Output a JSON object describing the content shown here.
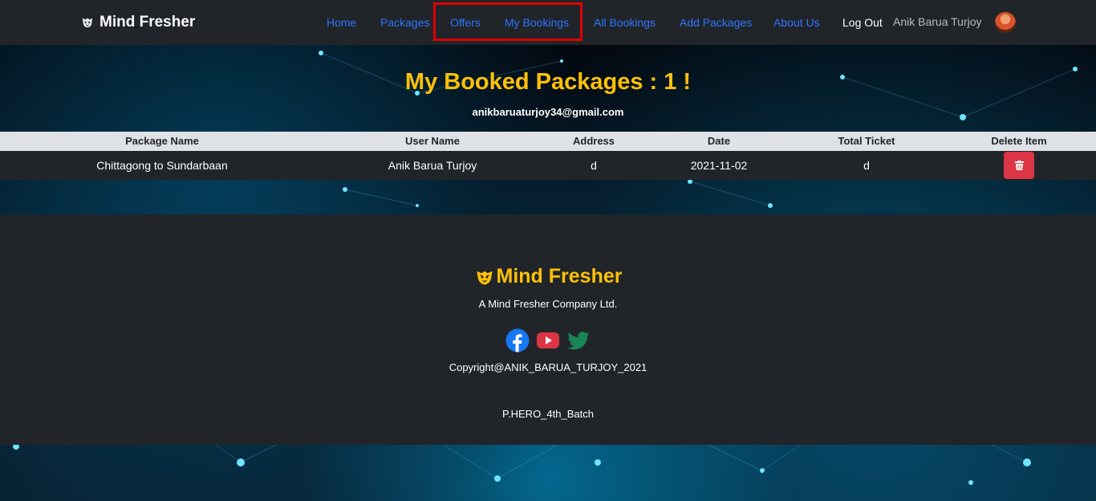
{
  "navbar": {
    "brand": "Mind Fresher",
    "links": [
      "Home",
      "Packages",
      "Offers",
      "My Bookings",
      "All Bookings",
      "Add Packages",
      "About Us"
    ],
    "logout": "Log Out",
    "user_name": "Anik Barua Turjoy",
    "link_color": "#2f74ff"
  },
  "main": {
    "title": "My Booked Packages : 1 !",
    "email": "anikbaruaturjoy34@gmail.com",
    "title_color": "#ffc107"
  },
  "table": {
    "headers": [
      "Package Name",
      "User Name",
      "Address",
      "Date",
      "Total Ticket",
      "Delete Item"
    ],
    "rows": [
      {
        "package": "Chittagong to Sundarbaan",
        "user": "Anik Barua Turjoy",
        "address": "d",
        "date": "2021-11-02",
        "tickets": "d",
        "delete_icon": "trash-icon"
      }
    ],
    "delete_color": "#dc3545"
  },
  "footer": {
    "brand": "Mind Fresher",
    "company": "A Mind Fresher Company Ltd.",
    "social_icons": [
      "facebook-icon",
      "youtube-icon",
      "twitter-icon"
    ],
    "copyright": "Copyright@ANIK_BARUA_TURJOY_2021",
    "batch": "P.HERO_4th_Batch"
  }
}
